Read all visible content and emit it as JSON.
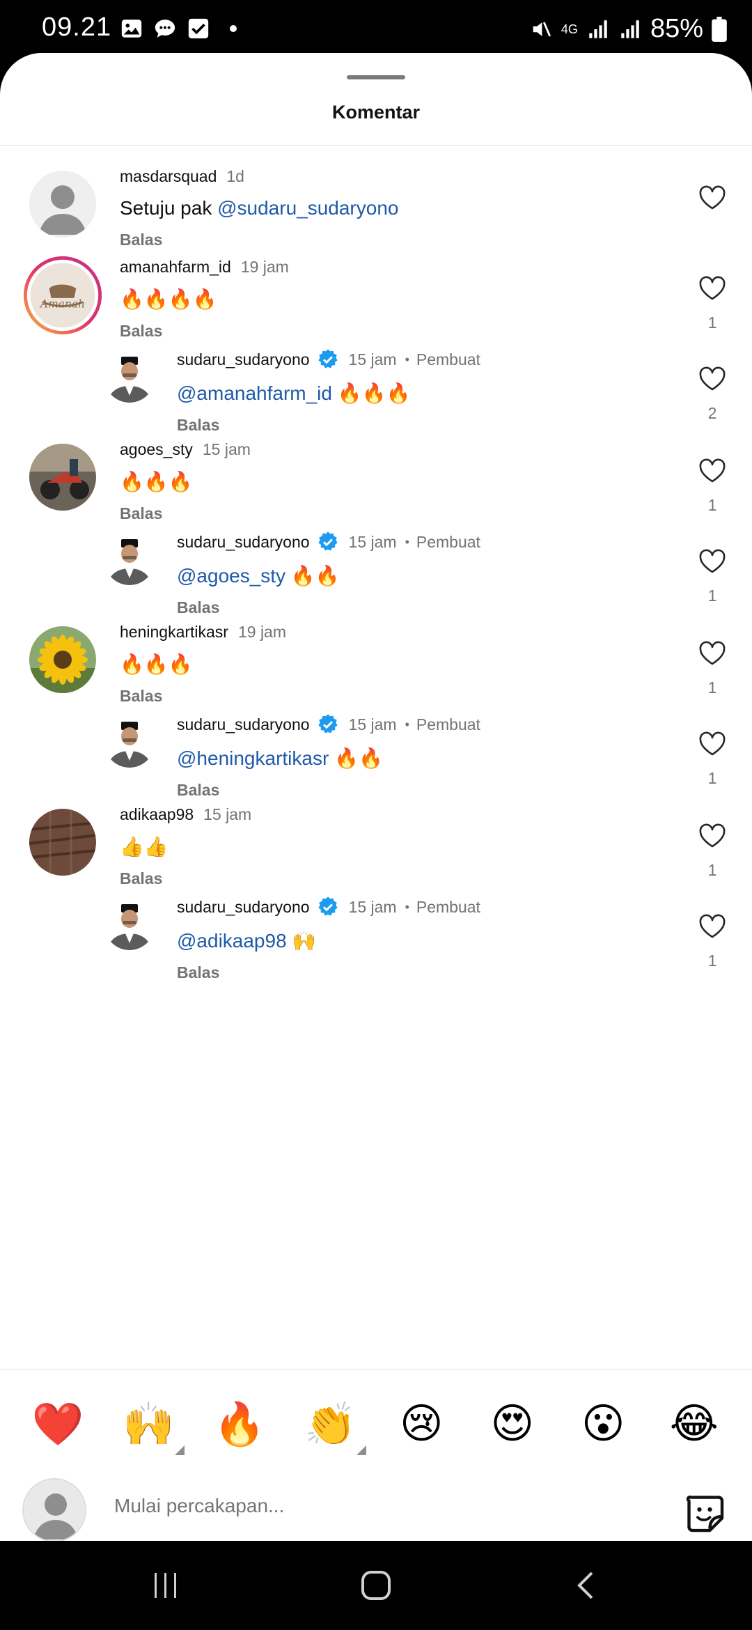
{
  "status_bar": {
    "time": "09.21",
    "network": "4G",
    "battery": "85%"
  },
  "sheet": {
    "title": "Komentar"
  },
  "comments": [
    {
      "user": "masdarsquad",
      "time": "1d",
      "text": "Setuju pak ",
      "mention": "@sudaru_sudaryono",
      "reply_label": "Balas",
      "likes": "",
      "avatar": "default-avatar"
    },
    {
      "user": "amanahfarm_id",
      "time": "19 jam",
      "text": "🔥🔥🔥🔥",
      "mention": "",
      "reply_label": "Balas",
      "likes": "1",
      "avatar": "amanah-logo-avatar"
    },
    {
      "user": "sudaru_sudaryono",
      "time": "15 jam",
      "creator": "Pembuat",
      "mention": "@amanahfarm_id",
      "text": " 🔥🔥🔥",
      "reply_label": "Balas",
      "likes": "2",
      "avatar": "sudaru-avatar"
    },
    {
      "user": "agoes_sty",
      "time": "15 jam",
      "text": "🔥🔥🔥",
      "mention": "",
      "reply_label": "Balas",
      "likes": "1",
      "avatar": "agoes-avatar"
    },
    {
      "user": "sudaru_sudaryono",
      "time": "15 jam",
      "creator": "Pembuat",
      "mention": "@agoes_sty",
      "text": " 🔥🔥",
      "reply_label": "Balas",
      "likes": "1",
      "avatar": "sudaru-avatar"
    },
    {
      "user": "heningkartikasr",
      "time": "19 jam",
      "text": "🔥🔥🔥",
      "mention": "",
      "reply_label": "Balas",
      "likes": "1",
      "avatar": "sunflower-avatar"
    },
    {
      "user": "sudaru_sudaryono",
      "time": "15 jam",
      "creator": "Pembuat",
      "mention": "@heningkartikasr",
      "text": " 🔥🔥",
      "reply_label": "Balas",
      "likes": "1",
      "avatar": "sudaru-avatar"
    },
    {
      "user": "adikaap98",
      "time": "15 jam",
      "text": "👍👍",
      "mention": "",
      "reply_label": "Balas",
      "likes": "1",
      "avatar": "adikaap-avatar"
    },
    {
      "user": "sudaru_sudaryono",
      "time": "15 jam",
      "creator": "Pembuat",
      "mention": "@adikaap98",
      "text": " 🙌",
      "reply_label": "Balas",
      "likes": "1",
      "avatar": "sudaru-avatar"
    }
  ],
  "emoji_bar": [
    "❤️",
    "🙌",
    "🔥",
    "👏",
    "😢",
    "😍",
    "😮",
    "😂"
  ],
  "composer": {
    "placeholder": "Mulai percakapan..."
  },
  "colors": {
    "mention": "#1e5aa8",
    "verified": "#1d9bf0",
    "muted": "#737373"
  }
}
